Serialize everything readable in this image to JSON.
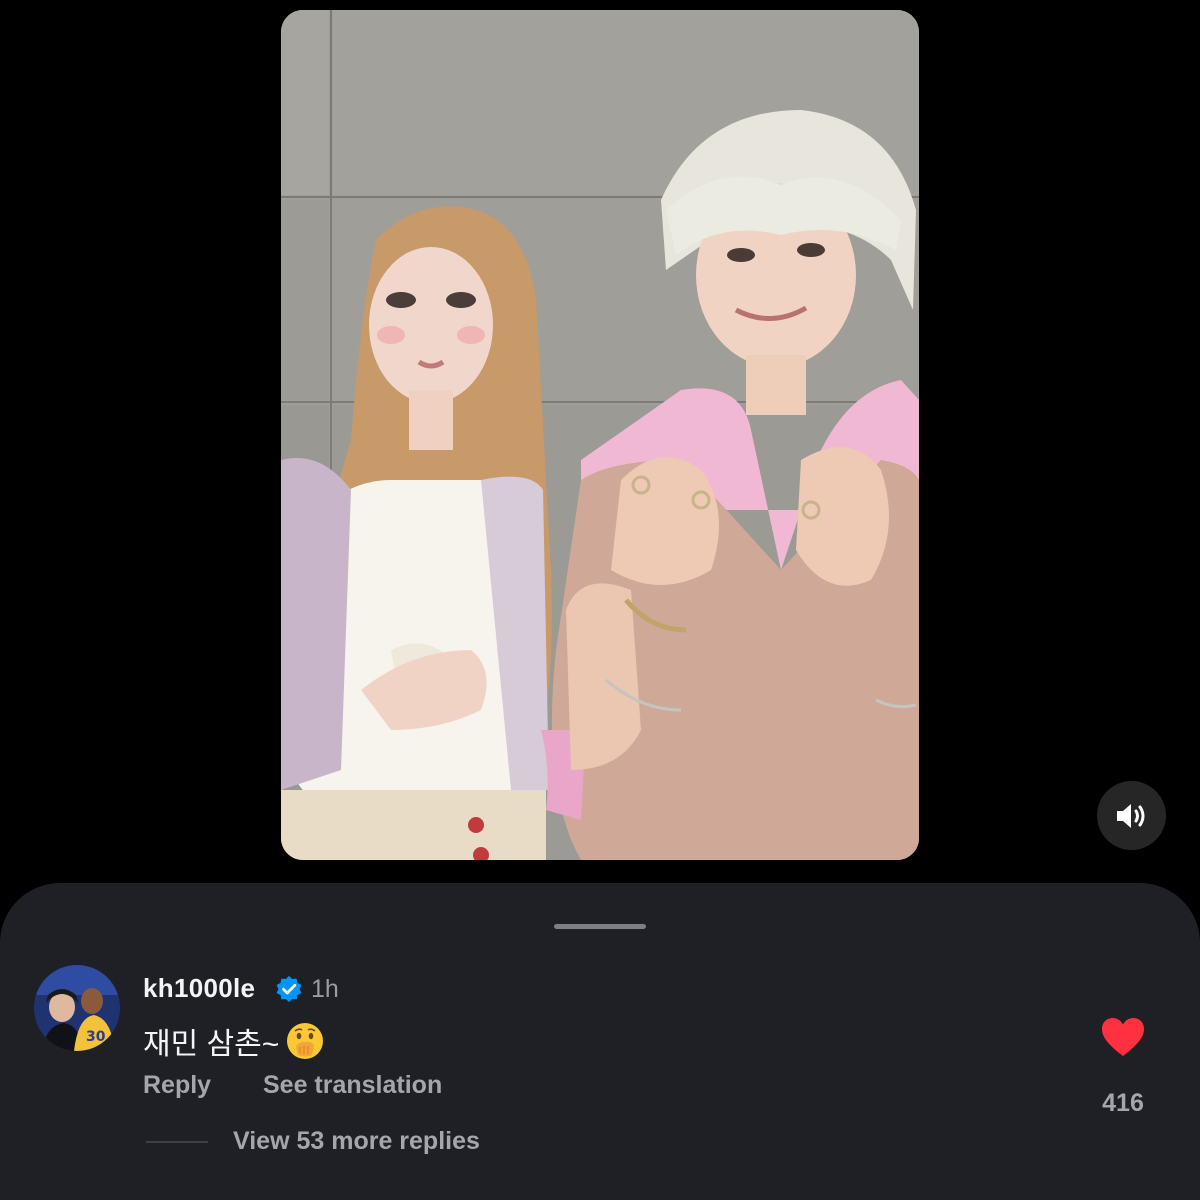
{
  "media": {
    "sound_icon": "speaker-sound-on-icon"
  },
  "comment": {
    "username": "kh1000le",
    "verified_icon": "verified-badge-icon",
    "timestamp": "1h",
    "text": "재민 삼촌~",
    "emoji_icon": "face-with-hand-over-mouth-emoji",
    "reply_label": "Reply",
    "translate_label": "See translation",
    "like_icon": "heart-filled-icon",
    "like_count": "416",
    "view_replies_label": "View 53 more replies"
  },
  "colors": {
    "background": "#000000",
    "sheet": "#1f2026",
    "primary_text": "#f3f4f6",
    "secondary_text": "#a4a6ad",
    "heart": "#ff3040",
    "verified": "#0095f6"
  }
}
